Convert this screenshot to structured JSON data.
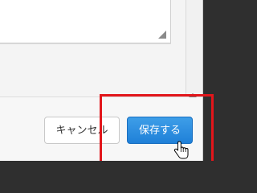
{
  "dialog": {
    "textarea_value": ""
  },
  "footer": {
    "cancel_label": "キャンセル",
    "save_label": "保存する"
  },
  "colors": {
    "save_button": "#1f80d8",
    "annotation": "#e2161b",
    "backdrop": "#2f2f2f"
  },
  "icons": {
    "resize_handle": "resize-grip-icon",
    "cursor": "hand-pointer-icon"
  }
}
